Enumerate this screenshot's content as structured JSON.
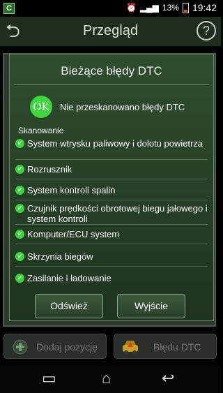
{
  "status_bar": {
    "battery": "13%",
    "time": "19:42"
  },
  "app_bar": {
    "title": "Przegląd"
  },
  "dialog": {
    "title": "Bieżące błędy DTC",
    "ok_badge": "OK",
    "ok_message": "Nie przeskanowano błędy DTC",
    "section_label": "Skanowanie",
    "items": [
      {
        "label": "System wtrysku paliwowy i dolotu powietrza"
      },
      {
        "label": "Rozrusznik"
      },
      {
        "label": "System kontroli spalin"
      },
      {
        "label": "Czujnik prędkości obrotowej biegu jałowego i system kontroli"
      },
      {
        "label": "Komputer/ECU system"
      },
      {
        "label": "Skrzynia biegów"
      },
      {
        "label": "Zasilanie i ładowanie"
      }
    ],
    "refresh_label": "Odśwież",
    "exit_label": "Wyjście"
  },
  "bottom_actions": {
    "add_item": "Dodaj pozycję",
    "dtc_errors": "Błędu DTC"
  }
}
